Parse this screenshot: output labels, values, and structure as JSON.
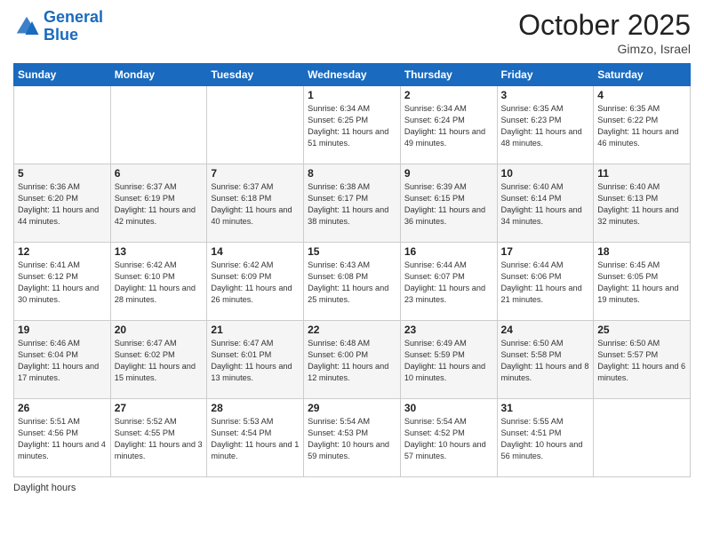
{
  "header": {
    "logo_line1": "General",
    "logo_line2": "Blue",
    "month": "October 2025",
    "location": "Gimzo, Israel"
  },
  "weekdays": [
    "Sunday",
    "Monday",
    "Tuesday",
    "Wednesday",
    "Thursday",
    "Friday",
    "Saturday"
  ],
  "legend": {
    "daylight_label": "Daylight hours"
  },
  "weeks": [
    [
      {
        "day": "",
        "sunrise": "",
        "sunset": "",
        "daylight": ""
      },
      {
        "day": "",
        "sunrise": "",
        "sunset": "",
        "daylight": ""
      },
      {
        "day": "",
        "sunrise": "",
        "sunset": "",
        "daylight": ""
      },
      {
        "day": "1",
        "sunrise": "Sunrise: 6:34 AM",
        "sunset": "Sunset: 6:25 PM",
        "daylight": "Daylight: 11 hours and 51 minutes."
      },
      {
        "day": "2",
        "sunrise": "Sunrise: 6:34 AM",
        "sunset": "Sunset: 6:24 PM",
        "daylight": "Daylight: 11 hours and 49 minutes."
      },
      {
        "day": "3",
        "sunrise": "Sunrise: 6:35 AM",
        "sunset": "Sunset: 6:23 PM",
        "daylight": "Daylight: 11 hours and 48 minutes."
      },
      {
        "day": "4",
        "sunrise": "Sunrise: 6:35 AM",
        "sunset": "Sunset: 6:22 PM",
        "daylight": "Daylight: 11 hours and 46 minutes."
      }
    ],
    [
      {
        "day": "5",
        "sunrise": "Sunrise: 6:36 AM",
        "sunset": "Sunset: 6:20 PM",
        "daylight": "Daylight: 11 hours and 44 minutes."
      },
      {
        "day": "6",
        "sunrise": "Sunrise: 6:37 AM",
        "sunset": "Sunset: 6:19 PM",
        "daylight": "Daylight: 11 hours and 42 minutes."
      },
      {
        "day": "7",
        "sunrise": "Sunrise: 6:37 AM",
        "sunset": "Sunset: 6:18 PM",
        "daylight": "Daylight: 11 hours and 40 minutes."
      },
      {
        "day": "8",
        "sunrise": "Sunrise: 6:38 AM",
        "sunset": "Sunset: 6:17 PM",
        "daylight": "Daylight: 11 hours and 38 minutes."
      },
      {
        "day": "9",
        "sunrise": "Sunrise: 6:39 AM",
        "sunset": "Sunset: 6:15 PM",
        "daylight": "Daylight: 11 hours and 36 minutes."
      },
      {
        "day": "10",
        "sunrise": "Sunrise: 6:40 AM",
        "sunset": "Sunset: 6:14 PM",
        "daylight": "Daylight: 11 hours and 34 minutes."
      },
      {
        "day": "11",
        "sunrise": "Sunrise: 6:40 AM",
        "sunset": "Sunset: 6:13 PM",
        "daylight": "Daylight: 11 hours and 32 minutes."
      }
    ],
    [
      {
        "day": "12",
        "sunrise": "Sunrise: 6:41 AM",
        "sunset": "Sunset: 6:12 PM",
        "daylight": "Daylight: 11 hours and 30 minutes."
      },
      {
        "day": "13",
        "sunrise": "Sunrise: 6:42 AM",
        "sunset": "Sunset: 6:10 PM",
        "daylight": "Daylight: 11 hours and 28 minutes."
      },
      {
        "day": "14",
        "sunrise": "Sunrise: 6:42 AM",
        "sunset": "Sunset: 6:09 PM",
        "daylight": "Daylight: 11 hours and 26 minutes."
      },
      {
        "day": "15",
        "sunrise": "Sunrise: 6:43 AM",
        "sunset": "Sunset: 6:08 PM",
        "daylight": "Daylight: 11 hours and 25 minutes."
      },
      {
        "day": "16",
        "sunrise": "Sunrise: 6:44 AM",
        "sunset": "Sunset: 6:07 PM",
        "daylight": "Daylight: 11 hours and 23 minutes."
      },
      {
        "day": "17",
        "sunrise": "Sunrise: 6:44 AM",
        "sunset": "Sunset: 6:06 PM",
        "daylight": "Daylight: 11 hours and 21 minutes."
      },
      {
        "day": "18",
        "sunrise": "Sunrise: 6:45 AM",
        "sunset": "Sunset: 6:05 PM",
        "daylight": "Daylight: 11 hours and 19 minutes."
      }
    ],
    [
      {
        "day": "19",
        "sunrise": "Sunrise: 6:46 AM",
        "sunset": "Sunset: 6:04 PM",
        "daylight": "Daylight: 11 hours and 17 minutes."
      },
      {
        "day": "20",
        "sunrise": "Sunrise: 6:47 AM",
        "sunset": "Sunset: 6:02 PM",
        "daylight": "Daylight: 11 hours and 15 minutes."
      },
      {
        "day": "21",
        "sunrise": "Sunrise: 6:47 AM",
        "sunset": "Sunset: 6:01 PM",
        "daylight": "Daylight: 11 hours and 13 minutes."
      },
      {
        "day": "22",
        "sunrise": "Sunrise: 6:48 AM",
        "sunset": "Sunset: 6:00 PM",
        "daylight": "Daylight: 11 hours and 12 minutes."
      },
      {
        "day": "23",
        "sunrise": "Sunrise: 6:49 AM",
        "sunset": "Sunset: 5:59 PM",
        "daylight": "Daylight: 11 hours and 10 minutes."
      },
      {
        "day": "24",
        "sunrise": "Sunrise: 6:50 AM",
        "sunset": "Sunset: 5:58 PM",
        "daylight": "Daylight: 11 hours and 8 minutes."
      },
      {
        "day": "25",
        "sunrise": "Sunrise: 6:50 AM",
        "sunset": "Sunset: 5:57 PM",
        "daylight": "Daylight: 11 hours and 6 minutes."
      }
    ],
    [
      {
        "day": "26",
        "sunrise": "Sunrise: 5:51 AM",
        "sunset": "Sunset: 4:56 PM",
        "daylight": "Daylight: 11 hours and 4 minutes."
      },
      {
        "day": "27",
        "sunrise": "Sunrise: 5:52 AM",
        "sunset": "Sunset: 4:55 PM",
        "daylight": "Daylight: 11 hours and 3 minutes."
      },
      {
        "day": "28",
        "sunrise": "Sunrise: 5:53 AM",
        "sunset": "Sunset: 4:54 PM",
        "daylight": "Daylight: 11 hours and 1 minute."
      },
      {
        "day": "29",
        "sunrise": "Sunrise: 5:54 AM",
        "sunset": "Sunset: 4:53 PM",
        "daylight": "Daylight: 10 hours and 59 minutes."
      },
      {
        "day": "30",
        "sunrise": "Sunrise: 5:54 AM",
        "sunset": "Sunset: 4:52 PM",
        "daylight": "Daylight: 10 hours and 57 minutes."
      },
      {
        "day": "31",
        "sunrise": "Sunrise: 5:55 AM",
        "sunset": "Sunset: 4:51 PM",
        "daylight": "Daylight: 10 hours and 56 minutes."
      },
      {
        "day": "",
        "sunrise": "",
        "sunset": "",
        "daylight": ""
      }
    ]
  ]
}
